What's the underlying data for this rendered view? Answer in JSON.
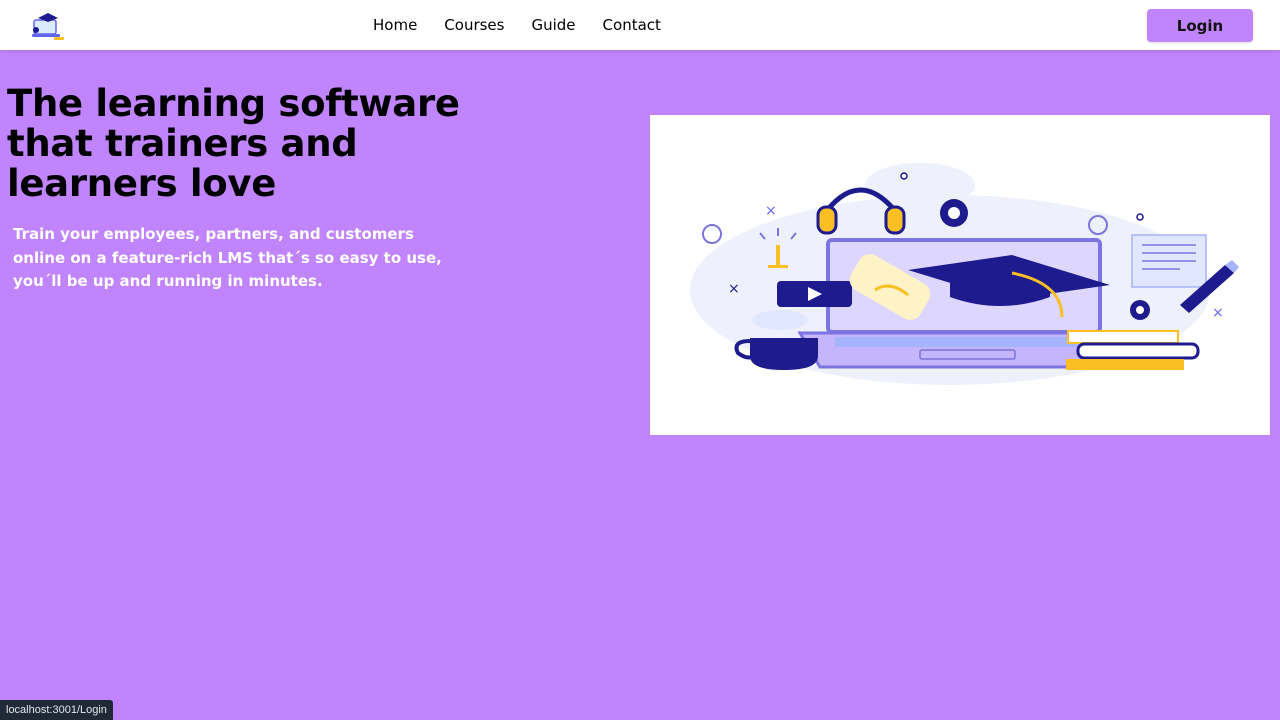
{
  "navbar": {
    "logo_icon": "graduation-laptop-logo",
    "links": [
      {
        "label": "Home"
      },
      {
        "label": "Courses"
      },
      {
        "label": "Guide"
      },
      {
        "label": "Contact"
      }
    ],
    "login_label": "Login"
  },
  "hero": {
    "title": "The learning software that trainers and learners love",
    "subtitle": "Train your employees, partners, and customers online on a feature-rich LMS that´s so easy to use, you´ll be up and running in minutes.",
    "illustration_icon": "e-learning-illustration"
  },
  "status_bar": {
    "url": "localhost:3001/Login"
  },
  "colors": {
    "background": "#c084fc",
    "navbar": "#ffffff",
    "accent_dark": "#1e1b8f",
    "accent_light": "#7c74e0",
    "accent_yellow": "#fbbf24"
  }
}
